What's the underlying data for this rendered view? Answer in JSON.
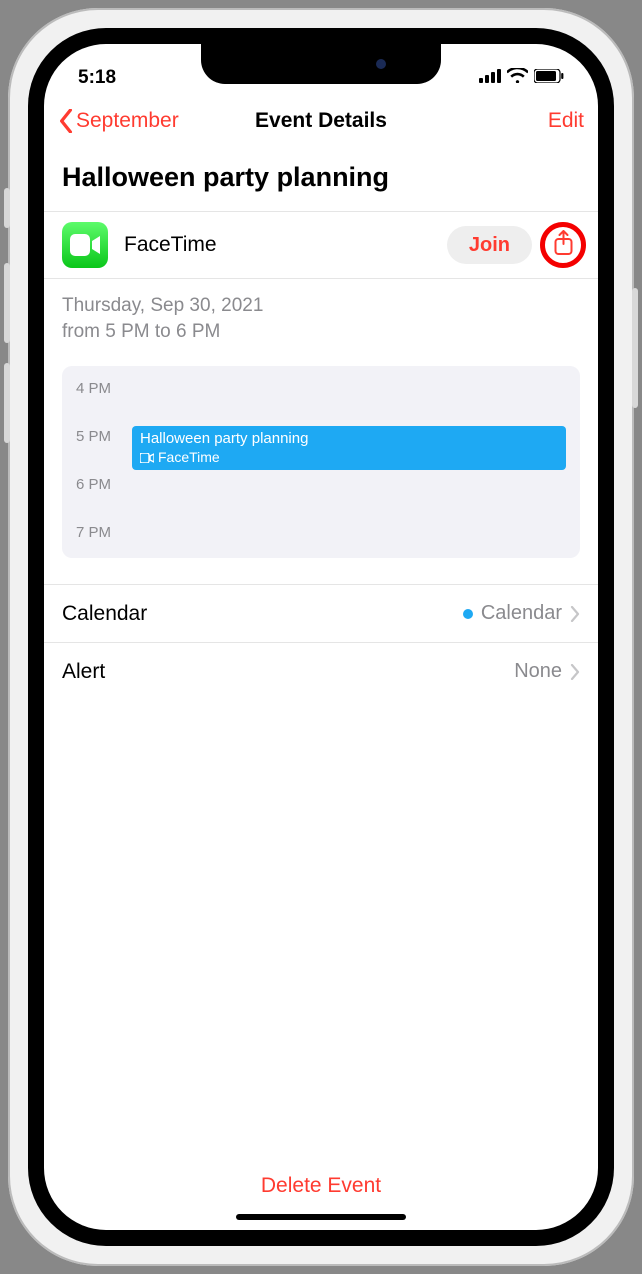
{
  "status": {
    "time": "5:18"
  },
  "nav": {
    "back": "September",
    "title": "Event Details",
    "edit": "Edit"
  },
  "event": {
    "title": "Halloween party planning",
    "facetime_label": "FaceTime",
    "join_label": "Join",
    "date_line": "Thursday, Sep 30, 2021",
    "time_line": "from 5 PM to 6 PM"
  },
  "timeline": {
    "hours": [
      "4 PM",
      "5 PM",
      "6 PM",
      "7 PM"
    ],
    "block": {
      "title": "Halloween party planning",
      "sub": "FaceTime"
    }
  },
  "rows": {
    "calendar_label": "Calendar",
    "calendar_value": "Calendar",
    "alert_label": "Alert",
    "alert_value": "None"
  },
  "delete_label": "Delete Event"
}
